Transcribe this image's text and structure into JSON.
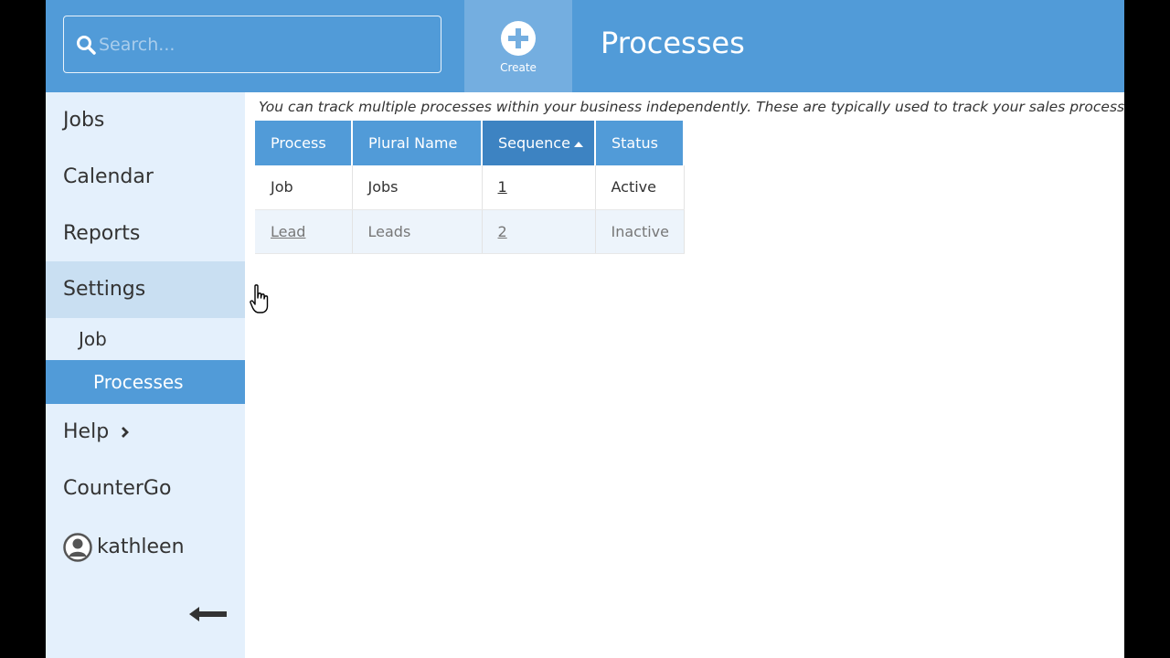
{
  "header": {
    "search_placeholder": "Search...",
    "create_label": "Create",
    "page_title": "Processes"
  },
  "sidebar": {
    "items": [
      {
        "label": "Jobs"
      },
      {
        "label": "Calendar"
      },
      {
        "label": "Reports"
      },
      {
        "label": "Settings"
      },
      {
        "label": "Help"
      },
      {
        "label": "CounterGo"
      }
    ],
    "sub_items": [
      {
        "label": "Job"
      },
      {
        "label": "Processes"
      }
    ],
    "user": {
      "name": "kathleen"
    }
  },
  "content": {
    "intro": "You can track multiple processes within your business independently. These are typically used to track your sales process s",
    "table": {
      "headers": [
        "Process",
        "Plural Name",
        "Sequence",
        "Status"
      ],
      "rows": [
        {
          "process": "Job",
          "plural": "Jobs",
          "sequence": "1",
          "status": "Active"
        },
        {
          "process": "Lead",
          "plural": "Leads",
          "sequence": "2",
          "status": "Inactive"
        }
      ]
    }
  },
  "colors": {
    "header_bg": "#519bd8",
    "create_bg": "#74aee0",
    "sidebar_bg": "#e4f0fc",
    "sidebar_selected": "#519bd8",
    "sorted_header": "#3d83c2"
  },
  "icons": [
    "search-icon",
    "plus-circle-icon",
    "chevron-right-icon",
    "user-circle-icon",
    "arrow-left-icon",
    "hand-cursor-icon"
  ]
}
